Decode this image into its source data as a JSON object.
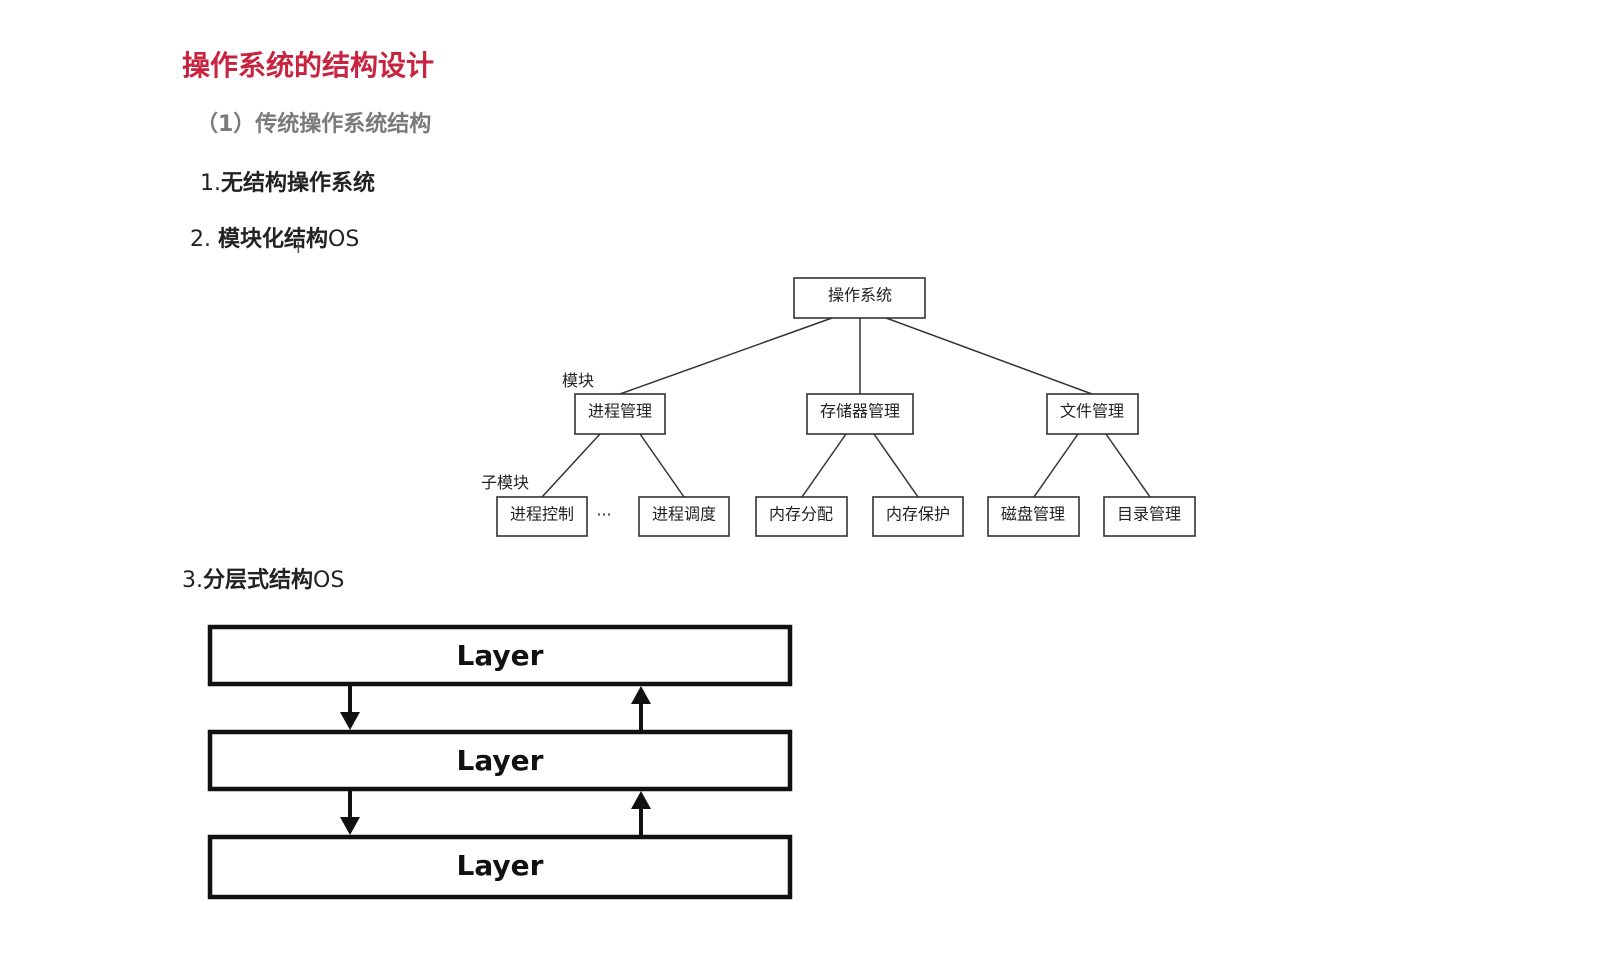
{
  "title": "操作系统的结构设计",
  "subtitle": "（1）传统操作系统结构",
  "items": [
    {
      "num": "1.",
      "bold": "无结构操作系统",
      "suffix": ""
    },
    {
      "num": "2. ",
      "bold": "模块化结构",
      "suffix": "OS"
    },
    {
      "num": "3.",
      "bold": "分层式结构",
      "suffix": "OS"
    }
  ],
  "module_tree": {
    "root": "操作系统",
    "modules": [
      "进程管理",
      "存储器管理",
      "文件管理"
    ],
    "submodules": [
      "进程控制",
      "进程调度",
      "内存分配",
      "内存保护",
      "磁盘管理",
      "目录管理"
    ],
    "ellipsis": "···",
    "module_label": "模块",
    "submodule_label": "子模块"
  },
  "layers": {
    "labels": [
      "Layer",
      "Layer",
      "Layer"
    ]
  }
}
